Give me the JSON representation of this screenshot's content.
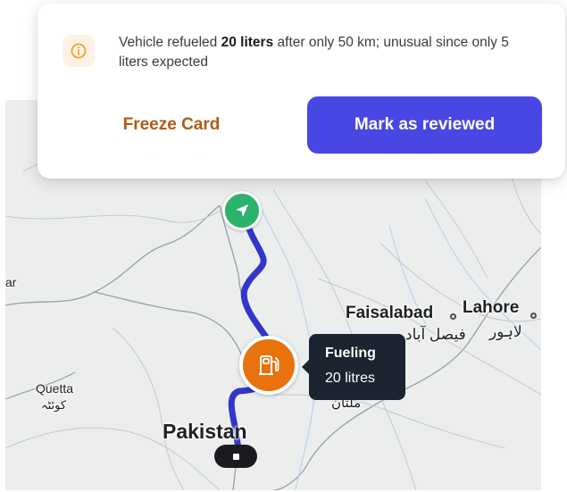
{
  "alert": {
    "icon": "info-icon",
    "message_parts": {
      "prefix": "Vehicle refueled ",
      "highlight": "20 liters",
      "suffix": " after only 50 km; unusual since only 5 liters expected"
    },
    "buttons": {
      "freeze_label": "Freeze Card",
      "review_label": "Mark as reviewed"
    }
  },
  "map": {
    "cities": {
      "faisalabad": "Faisalabad",
      "faisalabad_native": "فیصل آباد",
      "lahore": "Lahore",
      "lahore_native": "لاہور",
      "quetta": "Quetta",
      "quetta_native": "کوئٹہ",
      "multan_native": "ملتان",
      "country": "Pakistan",
      "edge_fragment": "ar"
    },
    "markers": {
      "start_icon": "navigation-arrow-icon",
      "fuel_icon": "fuel-pump-icon",
      "end_icon": "stop-square-icon"
    },
    "tooltip": {
      "title": "Fueling",
      "value": "20 litres"
    }
  },
  "colors": {
    "route": "#3236c9",
    "start_marker": "#2bb36b",
    "fuel_marker": "#e8720c",
    "primary_button": "#4847e4",
    "freeze_text": "#b35a14"
  }
}
